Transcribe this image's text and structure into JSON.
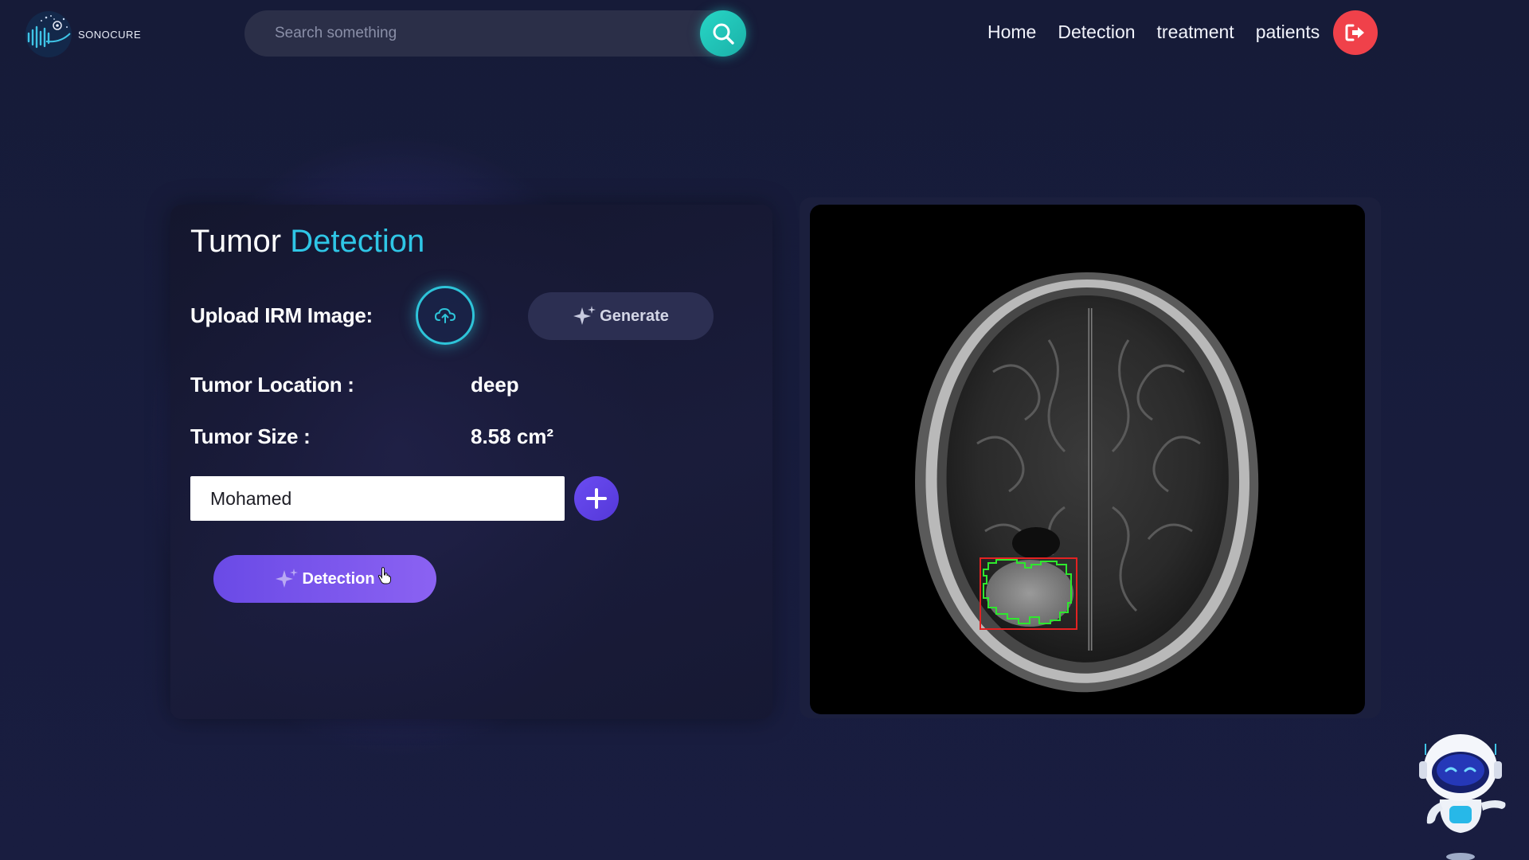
{
  "header": {
    "logo_text": "SONOCURE",
    "search": {
      "placeholder": "Search something"
    },
    "nav": [
      "Home",
      "Detection",
      "treatment",
      "patients"
    ]
  },
  "card": {
    "title_part1": "Tumor",
    "title_part2": "Detection",
    "upload_label": "Upload IRM Image:",
    "generate_label": "Generate",
    "location_label": "Tumor Location :",
    "location_value": "deep",
    "size_label": "Tumor Size :",
    "size_value": "8.58 cm²",
    "patient_name": "Mohamed",
    "detection_label": "Detection"
  },
  "colors": {
    "accent_cyan": "#2fc6e6",
    "accent_purple": "#6a4ae6",
    "logout_red": "#f0414a",
    "search_teal": "#27d6c6"
  },
  "icons": [
    "search-icon",
    "logout-icon",
    "upload-cloud-icon",
    "sparkle-icon",
    "plus-icon",
    "robot-assistant-icon"
  ]
}
